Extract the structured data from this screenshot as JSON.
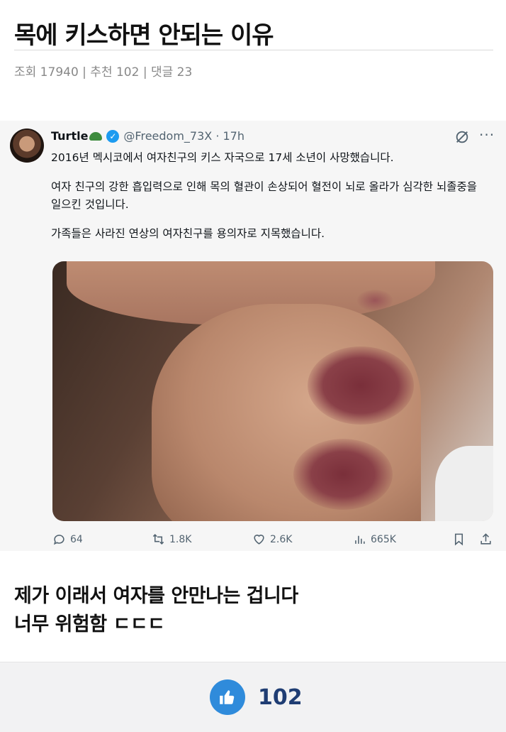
{
  "post": {
    "title": "목에 키스하면 안되는 이유",
    "meta": "조회 17940 | 추천 102 | 댓글 23"
  },
  "tweet": {
    "author_name": "Turtle",
    "handle_time": "@Freedom_73X · 17h",
    "paragraphs": [
      "2016년 멕시코에서 여자친구의 키스 자국으로 17세 소년이 사망했습니다.",
      "여자 친구의 강한 흡입력으로 인해 목의 혈관이 손상되어 혈전이 뇌로 올라가 심각한 뇌졸중을 일으킨 것입니다.",
      "가족들은 사라진 연상의 여자친구를 용의자로 지목했습니다."
    ],
    "stats": {
      "replies": "64",
      "retweets": "1.8K",
      "likes": "2.6K",
      "views": "665K"
    }
  },
  "body": {
    "line1": "제가 이래서 여자를 안만나는 겁니다",
    "line2": "너무 위험함 ㄷㄷㄷ"
  },
  "recommend": {
    "count": "102"
  },
  "colors": {
    "verified": "#1d9bf0",
    "like_button": "#2f8bdb",
    "like_count": "#1f3d73"
  }
}
